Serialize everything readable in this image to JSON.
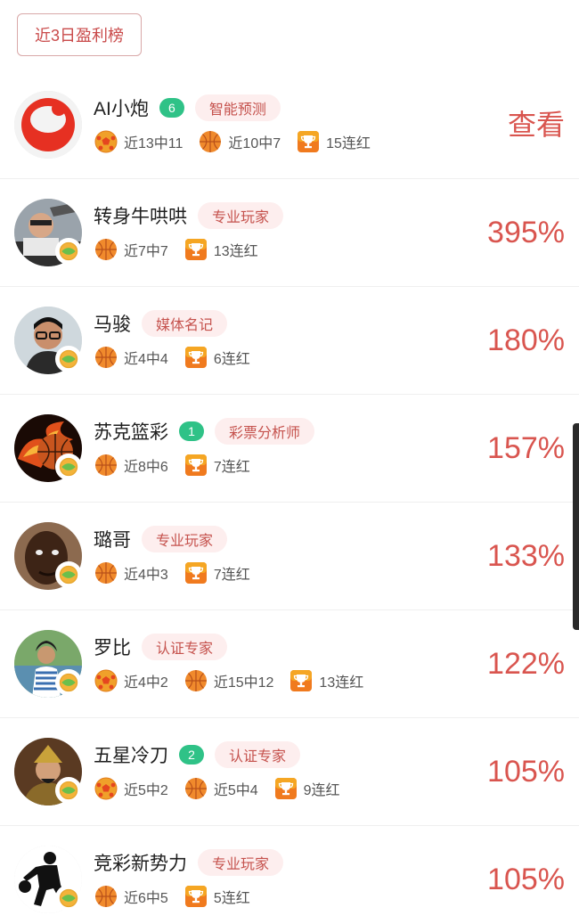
{
  "tab": {
    "label": "近3日盈利榜"
  },
  "colors": {
    "accent": "#d9554f",
    "tag_bg": "#fdeeee",
    "rank_badge": "#2fc287"
  },
  "rows": [
    {
      "name": "AI小炮",
      "rank": "6",
      "tag": "智能预测",
      "value": "查看",
      "stats": [
        {
          "icon": "football-icon",
          "text": "近13中11"
        },
        {
          "icon": "basketball-icon",
          "text": "近10中7"
        },
        {
          "icon": "trophy-icon",
          "text": "15连红"
        }
      ]
    },
    {
      "name": "转身牛哄哄",
      "rank": "",
      "tag": "专业玩家",
      "value": "395%",
      "stats": [
        {
          "icon": "basketball-icon",
          "text": "近7中7"
        },
        {
          "icon": "trophy-icon",
          "text": "13连红"
        }
      ]
    },
    {
      "name": "马骏",
      "rank": "",
      "tag": "媒体名记",
      "value": "180%",
      "stats": [
        {
          "icon": "basketball-icon",
          "text": "近4中4"
        },
        {
          "icon": "trophy-icon",
          "text": "6连红"
        }
      ]
    },
    {
      "name": "苏克篮彩",
      "rank": "1",
      "tag": "彩票分析师",
      "value": "157%",
      "stats": [
        {
          "icon": "basketball-icon",
          "text": "近8中6"
        },
        {
          "icon": "trophy-icon",
          "text": "7连红"
        }
      ]
    },
    {
      "name": "璐哥",
      "rank": "",
      "tag": "专业玩家",
      "value": "133%",
      "stats": [
        {
          "icon": "basketball-icon",
          "text": "近4中3"
        },
        {
          "icon": "trophy-icon",
          "text": "7连红"
        }
      ]
    },
    {
      "name": "罗比",
      "rank": "",
      "tag": "认证专家",
      "value": "122%",
      "stats": [
        {
          "icon": "football-icon",
          "text": "近4中2"
        },
        {
          "icon": "basketball-icon",
          "text": "近15中12"
        },
        {
          "icon": "trophy-icon",
          "text": "13连红"
        }
      ]
    },
    {
      "name": "五星冷刀",
      "rank": "2",
      "tag": "认证专家",
      "value": "105%",
      "stats": [
        {
          "icon": "football-icon",
          "text": "近5中2"
        },
        {
          "icon": "basketball-icon",
          "text": "近5中4"
        },
        {
          "icon": "trophy-icon",
          "text": "9连红"
        }
      ]
    },
    {
      "name": "竞彩新势力",
      "rank": "",
      "tag": "专业玩家",
      "value": "105%",
      "stats": [
        {
          "icon": "basketball-icon",
          "text": "近6中5"
        },
        {
          "icon": "trophy-icon",
          "text": "5连红"
        }
      ]
    }
  ]
}
